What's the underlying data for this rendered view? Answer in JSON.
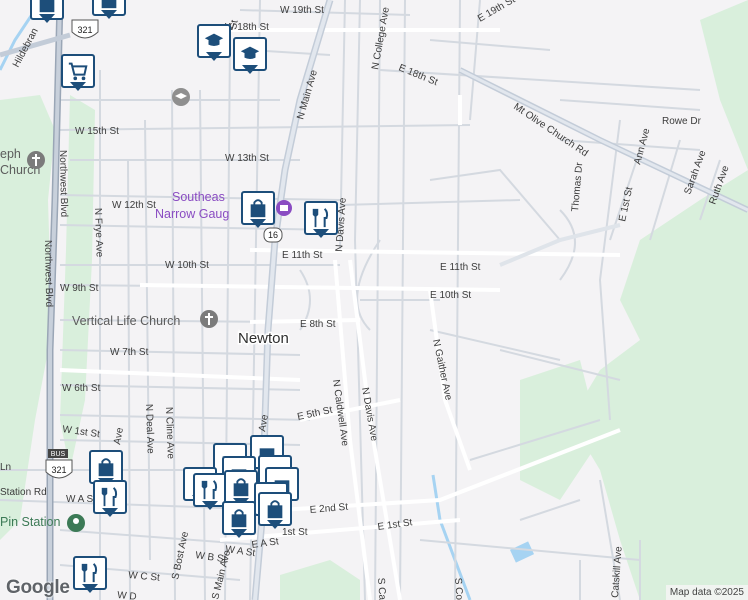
{
  "map": {
    "city_label": "Newton",
    "streets": {
      "w19th": "W 19th St",
      "w18th": "W 18th St",
      "e19th": "E 19th St",
      "e18th": "E 18th St",
      "w15th": "W 15th St",
      "w13th": "W 13th St",
      "w12th": "W 12th St",
      "e11th_w": "E 11th St",
      "e11th_e": "E 11th St",
      "w10th": "W 10th St",
      "e10th": "E 10th St",
      "w9th": "W 9th St",
      "e8th": "E 8th St",
      "w7th": "W 7th St",
      "w6th": "W 6th St",
      "e5th": "E 5th St",
      "w1st": "W 1st St",
      "e2nd": "E 2nd St",
      "e1st": "E 1st St",
      "wbst": "W B St",
      "west_ast": "W A St",
      "east_ast": "E A St",
      "wcst": "W C St",
      "n_college": "N College Ave",
      "n_main": "N Main Ave",
      "n_davis_top": "N Davis Ave",
      "n_davis": "N Davis Ave",
      "n_caldwell": "N Caldwell Ave",
      "n_gaither": "N Gaither Ave",
      "n_frye": "N Frye Ave",
      "n_deal": "N Deal Ave",
      "n_cline": "N Cline Ave",
      "northwest_blvd_top": "Northwest Blvd",
      "northwest_blvd": "Northwest Blvd",
      "mt_olive": "Mt Olive Church Rd",
      "rowe": "Rowe Dr",
      "thomas": "Thomas Dr",
      "ann": "Ann Ave",
      "sarah": "Sarah Ave",
      "ruth": "Ruth Ave",
      "e1st_v": "E 1st St",
      "s_bost": "S Bost Ave",
      "s_main": "S Main Ave",
      "s_caldwell": "S Ca",
      "s_college": "S Co",
      "catskill": "Catskill Ave",
      "station_rd": "Station Rd",
      "hildebran": "Hildebran",
      "ave_frag": "Ave",
      "st_frag": "St",
      "frag_ln": "Ln",
      "frag_a": "W A S",
      "frag_1st": "1st St",
      "frag_ave2": "Ave",
      "frag_w_d": "W D"
    },
    "pois": {
      "southeast_line1": "Southeas",
      "southeast_line2": "Narrow Gaug",
      "vertical_life": "Vertical Life Church",
      "pin_station": "Pin Station",
      "joseph_line1": "eph",
      "joseph_line2": "Church"
    },
    "shields": {
      "us321_top": "321",
      "us321_bottom": "321",
      "bus": "BUS",
      "nc16": "16"
    },
    "colors": {
      "background": "#f4f3f5",
      "park": "#d9efdc",
      "road": "#ffffff",
      "road_major": "#c9d2dd",
      "water": "#a6d3f2",
      "pin_border": "#1d4e7a",
      "poi_purple": "#8a4cc2"
    }
  },
  "pins": [
    {
      "icon": "graduation-cap-icon"
    },
    {
      "icon": "graduation-cap-icon"
    },
    {
      "icon": "shopping-cart-icon"
    },
    {
      "icon": "shopping-bag-icon"
    },
    {
      "icon": "fork-knife-icon"
    },
    {
      "icon": "shopping-bag-icon"
    },
    {
      "icon": "fork-knife-icon"
    },
    {
      "icon": "shopping-bag-icon"
    },
    {
      "icon": "shopping-bag-icon"
    },
    {
      "icon": "fork-knife-icon"
    }
  ],
  "footer": {
    "logo": "Google",
    "attribution": "Map data ©2025"
  }
}
